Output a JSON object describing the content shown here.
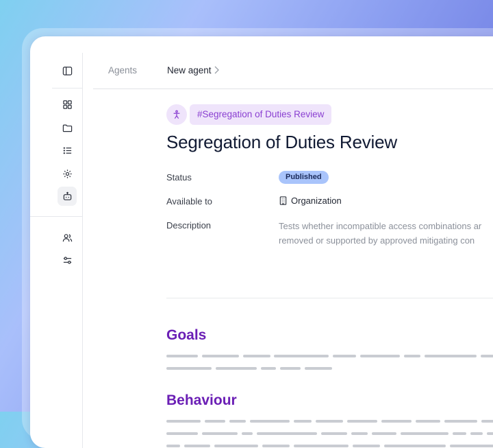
{
  "breadcrumb": {
    "parent": "Agents",
    "current": "New agent"
  },
  "agent": {
    "tag": "#Segregation of Duties Review",
    "title": "Segregation of Duties Review",
    "status_label": "Status",
    "status_value": "Published",
    "available_label": "Available to",
    "available_value": "Organization",
    "description_label": "Description",
    "description_line1": "Tests whether incompatible access combinations ar",
    "description_line2": "removed or supported by approved mitigating con"
  },
  "sections": {
    "goals": "Goals",
    "behaviour": "Behaviour"
  },
  "sidebar": {
    "icons": [
      "panel-toggle-icon",
      "dashboard-icon",
      "folder-icon",
      "list-icon",
      "settings-icon",
      "bot-icon",
      "users-icon",
      "sliders-icon"
    ],
    "active": "bot-icon"
  },
  "colors": {
    "accent": "#6b1fb5",
    "tag_text": "#8a3fd1",
    "tag_bg": "#efe4fb",
    "badge_bg": "#a9c4fb"
  }
}
